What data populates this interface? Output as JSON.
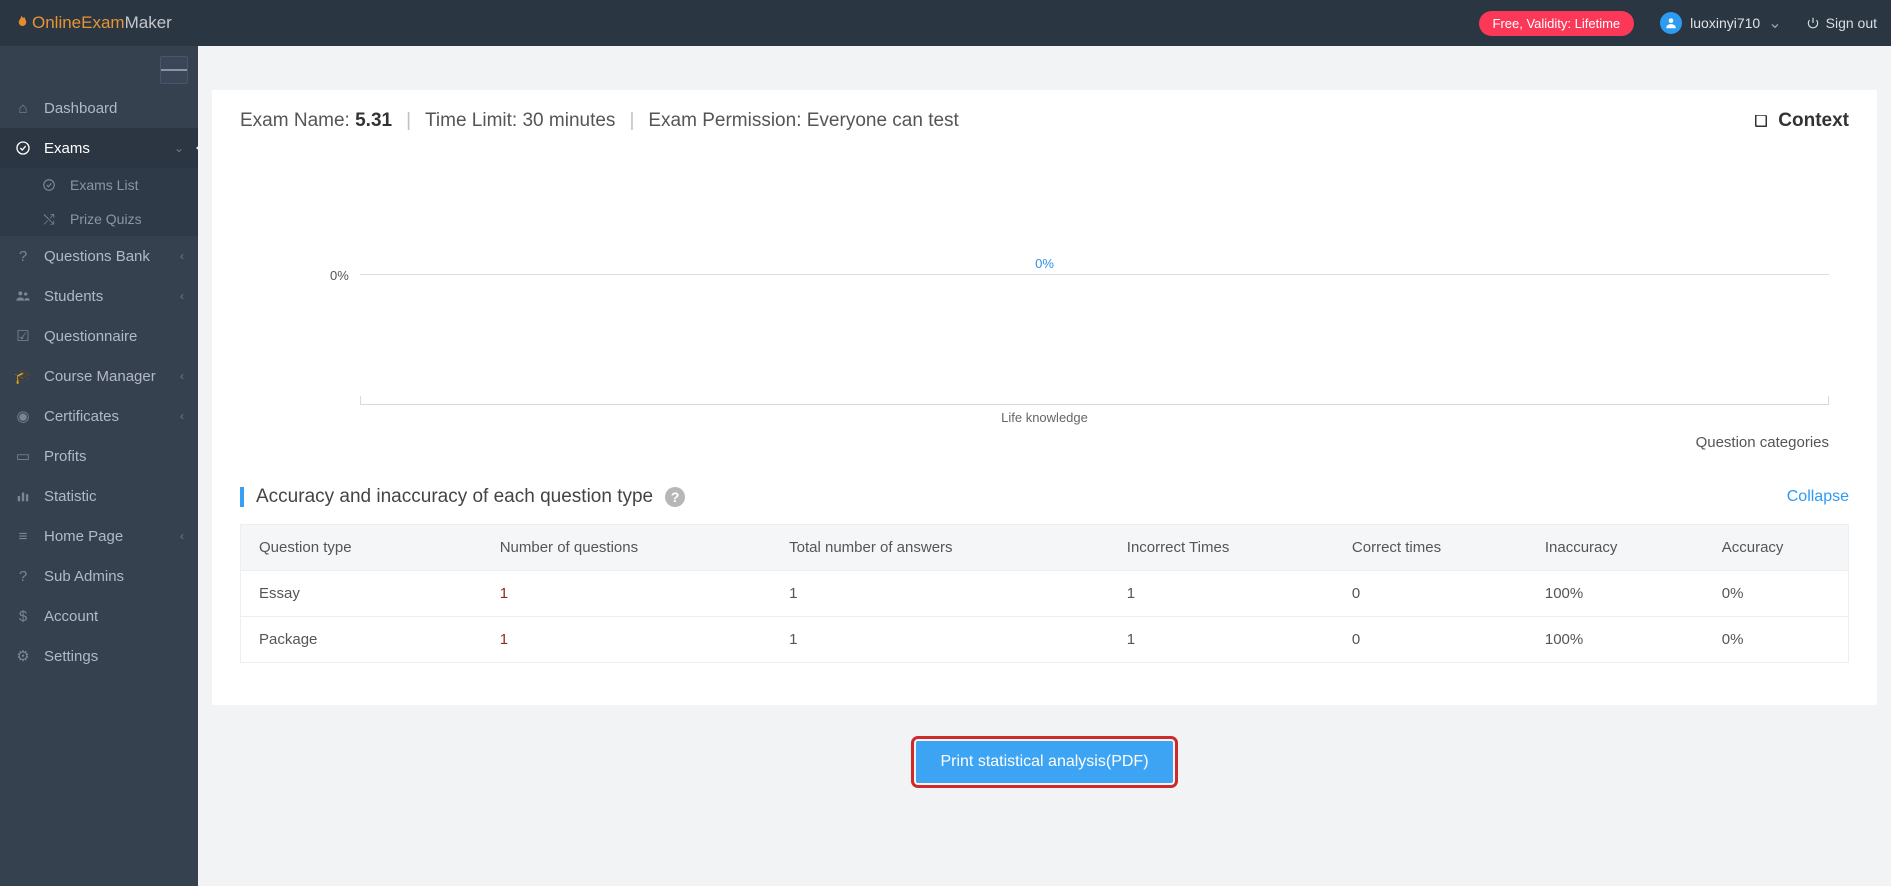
{
  "brand": {
    "a": "OnlineExam",
    "b": "Maker"
  },
  "topbar": {
    "pill": "Free, Validity: Lifetime",
    "username": "luoxinyi710",
    "signout": "Sign out"
  },
  "sidebar": {
    "dashboard": "Dashboard",
    "exams": "Exams",
    "exams_list": "Exams List",
    "prize_quizs": "Prize Quizs",
    "questions_bank": "Questions Bank",
    "students": "Students",
    "questionnaire": "Questionnaire",
    "course_manager": "Course Manager",
    "certificates": "Certificates",
    "profits": "Profits",
    "statistic": "Statistic",
    "home_page": "Home Page",
    "sub_admins": "Sub Admins",
    "account": "Account",
    "settings": "Settings"
  },
  "header": {
    "exam_name_label": "Exam Name: ",
    "exam_name_value": "5.31",
    "time_limit": "Time Limit: 30 minutes",
    "permission": "Exam Permission: Everyone can test",
    "context": "Context"
  },
  "chart_data": {
    "type": "bar",
    "categories": [
      "Life knowledge"
    ],
    "values": [
      0
    ],
    "value_labels": [
      "0%"
    ],
    "y_ticks": [
      "0%"
    ],
    "xlabel": "Question categories",
    "title": "",
    "ylabel": "",
    "ylim": [
      0,
      0
    ]
  },
  "section": {
    "title": "Accuracy and inaccuracy of each question type",
    "collapse": "Collapse"
  },
  "table": {
    "headers": [
      "Question type",
      "Number of questions",
      "Total number of answers",
      "Incorrect Times",
      "Correct times",
      "Inaccuracy",
      "Accuracy"
    ],
    "rows": [
      {
        "type": "Essay",
        "numq": "1",
        "answers": "1",
        "incorrect": "1",
        "correct": "0",
        "inaccuracy": "100%",
        "accuracy": "0%"
      },
      {
        "type": "Package",
        "numq": "1",
        "answers": "1",
        "incorrect": "1",
        "correct": "0",
        "inaccuracy": "100%",
        "accuracy": "0%"
      }
    ]
  },
  "print_button": "Print statistical analysis(PDF)"
}
